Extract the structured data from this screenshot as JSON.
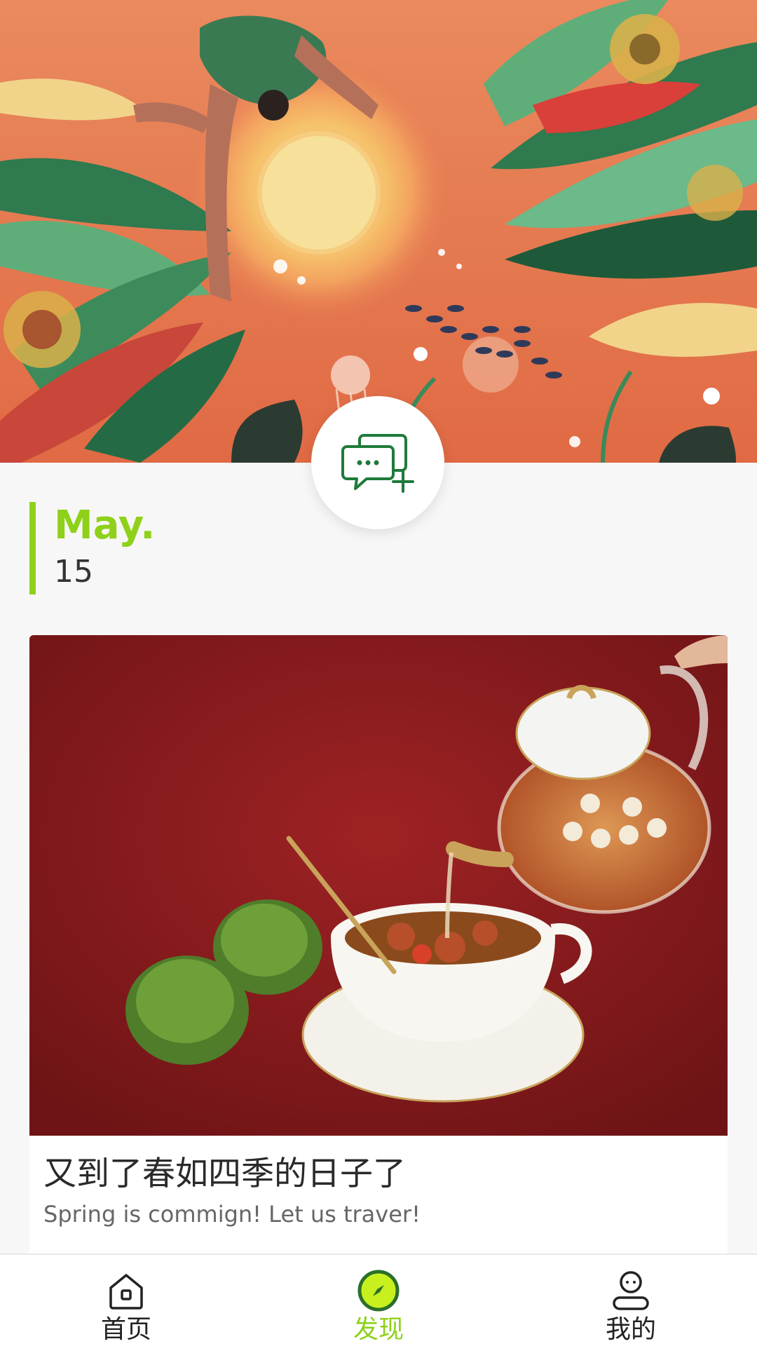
{
  "colors": {
    "accent": "#8fd11a",
    "fab_icon": "#1f7a3a",
    "text_primary": "#2a2a2a",
    "text_secondary": "#666666",
    "background": "#f7f7f7"
  },
  "hero": {
    "image": "illustration-nature-sun-figure-jellyfish",
    "icon": "hero-illustration"
  },
  "fab": {
    "icon": "add-comment-icon"
  },
  "date": {
    "month": "May.",
    "day": "15"
  },
  "article": {
    "image": "tea-pouring-photo",
    "title": "又到了春如四季的日子了",
    "subtitle": "Spring is commign! Let us traver!"
  },
  "bottom_nav": {
    "active_index": 1,
    "items": [
      {
        "label": "首页",
        "icon": "home-icon"
      },
      {
        "label": "发现",
        "icon": "compass-icon"
      },
      {
        "label": "我的",
        "icon": "profile-icon"
      }
    ]
  }
}
